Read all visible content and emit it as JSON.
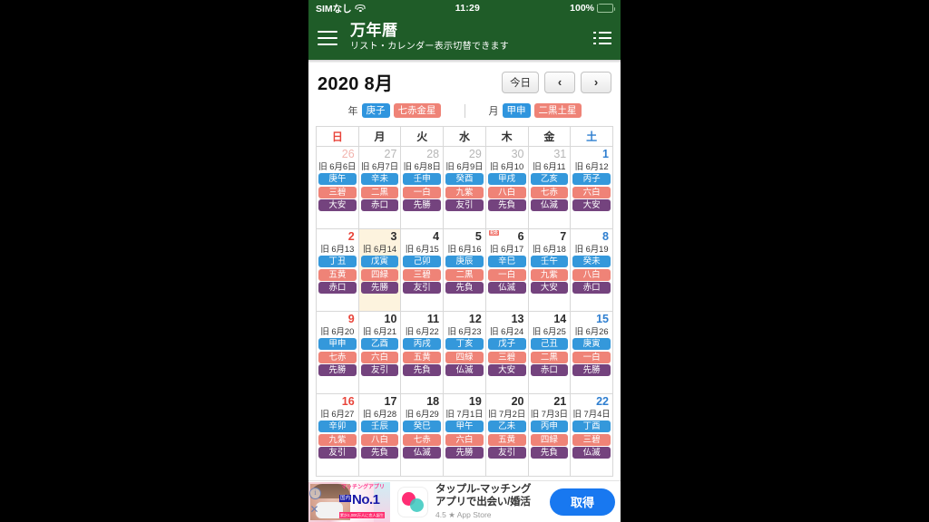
{
  "status_bar": {
    "carrier": "SIMなし",
    "time": "11:29",
    "battery": "100%",
    "wifi_icon": "wifi-icon",
    "battery_icon": "battery-charging-icon"
  },
  "app_bar": {
    "menu_icon": "hamburger-menu-icon",
    "title": "万年暦",
    "subtitle": "リスト・カレンダー表示切替できます",
    "list_icon": "list-view-icon"
  },
  "month_header": {
    "title": "2020 8月",
    "today_button": "今日",
    "prev_button": "‹",
    "next_button": "›"
  },
  "eto_row": {
    "year_label": "年",
    "year_kanshi": "庚子",
    "year_kyusei": "七赤金星",
    "month_label": "月",
    "month_kanshi": "甲申",
    "month_kyusei": "二黒土星"
  },
  "calendar": {
    "weekdays": [
      "日",
      "月",
      "火",
      "水",
      "木",
      "金",
      "土"
    ],
    "weeks": [
      [
        {
          "day": "26",
          "kyureki": "旧 6月6日",
          "kanshi": "庚午",
          "kyusei": "三碧",
          "rokuyo": "大安",
          "outside": true,
          "today": false,
          "holiday": false
        },
        {
          "day": "27",
          "kyureki": "旧 6月7日",
          "kanshi": "辛未",
          "kyusei": "二黒",
          "rokuyo": "赤口",
          "outside": true,
          "today": false,
          "holiday": false
        },
        {
          "day": "28",
          "kyureki": "旧 6月8日",
          "kanshi": "壬申",
          "kyusei": "一白",
          "rokuyo": "先勝",
          "outside": true,
          "today": false,
          "holiday": false
        },
        {
          "day": "29",
          "kyureki": "旧 6月9日",
          "kanshi": "癸酉",
          "kyusei": "九紫",
          "rokuyo": "友引",
          "outside": true,
          "today": false,
          "holiday": false
        },
        {
          "day": "30",
          "kyureki": "旧 6月10",
          "kanshi": "甲戌",
          "kyusei": "八白",
          "rokuyo": "先負",
          "outside": true,
          "today": false,
          "holiday": false
        },
        {
          "day": "31",
          "kyureki": "旧 6月11",
          "kanshi": "乙亥",
          "kyusei": "七赤",
          "rokuyo": "仏滅",
          "outside": true,
          "today": false,
          "holiday": false
        },
        {
          "day": "1",
          "kyureki": "旧 6月12",
          "kanshi": "丙子",
          "kyusei": "六白",
          "rokuyo": "大安",
          "outside": false,
          "today": false,
          "holiday": false
        }
      ],
      [
        {
          "day": "2",
          "kyureki": "旧 6月13",
          "kanshi": "丁丑",
          "kyusei": "五黄",
          "rokuyo": "赤口",
          "outside": false,
          "today": false,
          "holiday": false
        },
        {
          "day": "3",
          "kyureki": "旧 6月14",
          "kanshi": "戊寅",
          "kyusei": "四緑",
          "rokuyo": "先勝",
          "outside": false,
          "today": true,
          "holiday": false
        },
        {
          "day": "4",
          "kyureki": "旧 6月15",
          "kanshi": "己卯",
          "kyusei": "三碧",
          "rokuyo": "友引",
          "outside": false,
          "today": false,
          "holiday": false
        },
        {
          "day": "5",
          "kyureki": "旧 6月16",
          "kanshi": "庚辰",
          "kyusei": "二黒",
          "rokuyo": "先負",
          "outside": false,
          "today": false,
          "holiday": false
        },
        {
          "day": "6",
          "kyureki": "旧 6月17",
          "kanshi": "辛巳",
          "kyusei": "一白",
          "rokuyo": "仏滅",
          "outside": false,
          "today": false,
          "holiday": true,
          "holiday_label": "記念"
        },
        {
          "day": "7",
          "kyureki": "旧 6月18",
          "kanshi": "壬午",
          "kyusei": "九紫",
          "rokuyo": "大安",
          "outside": false,
          "today": false,
          "holiday": false
        },
        {
          "day": "8",
          "kyureki": "旧 6月19",
          "kanshi": "癸未",
          "kyusei": "八白",
          "rokuyo": "赤口",
          "outside": false,
          "today": false,
          "holiday": false
        }
      ],
      [
        {
          "day": "9",
          "kyureki": "旧 6月20",
          "kanshi": "甲申",
          "kyusei": "七赤",
          "rokuyo": "先勝",
          "outside": false,
          "today": false,
          "holiday": false
        },
        {
          "day": "10",
          "kyureki": "旧 6月21",
          "kanshi": "乙酉",
          "kyusei": "六白",
          "rokuyo": "友引",
          "outside": false,
          "today": false,
          "holiday": false
        },
        {
          "day": "11",
          "kyureki": "旧 6月22",
          "kanshi": "丙戌",
          "kyusei": "五黄",
          "rokuyo": "先負",
          "outside": false,
          "today": false,
          "holiday": false
        },
        {
          "day": "12",
          "kyureki": "旧 6月23",
          "kanshi": "丁亥",
          "kyusei": "四緑",
          "rokuyo": "仏滅",
          "outside": false,
          "today": false,
          "holiday": false
        },
        {
          "day": "13",
          "kyureki": "旧 6月24",
          "kanshi": "戊子",
          "kyusei": "三碧",
          "rokuyo": "大安",
          "outside": false,
          "today": false,
          "holiday": false
        },
        {
          "day": "14",
          "kyureki": "旧 6月25",
          "kanshi": "己丑",
          "kyusei": "二黒",
          "rokuyo": "赤口",
          "outside": false,
          "today": false,
          "holiday": false
        },
        {
          "day": "15",
          "kyureki": "旧 6月26",
          "kanshi": "庚寅",
          "kyusei": "一白",
          "rokuyo": "先勝",
          "outside": false,
          "today": false,
          "holiday": false
        }
      ],
      [
        {
          "day": "16",
          "kyureki": "旧 6月27",
          "kanshi": "辛卯",
          "kyusei": "九紫",
          "rokuyo": "友引",
          "outside": false,
          "today": false,
          "holiday": false
        },
        {
          "day": "17",
          "kyureki": "旧 6月28",
          "kanshi": "壬辰",
          "kyusei": "八白",
          "rokuyo": "先負",
          "outside": false,
          "today": false,
          "holiday": false
        },
        {
          "day": "18",
          "kyureki": "旧 6月29",
          "kanshi": "癸巳",
          "kyusei": "七赤",
          "rokuyo": "仏滅",
          "outside": false,
          "today": false,
          "holiday": false
        },
        {
          "day": "19",
          "kyureki": "旧 7月1日",
          "kanshi": "甲午",
          "kyusei": "六白",
          "rokuyo": "先勝",
          "outside": false,
          "today": false,
          "holiday": false
        },
        {
          "day": "20",
          "kyureki": "旧 7月2日",
          "kanshi": "乙未",
          "kyusei": "五黄",
          "rokuyo": "友引",
          "outside": false,
          "today": false,
          "holiday": false
        },
        {
          "day": "21",
          "kyureki": "旧 7月3日",
          "kanshi": "丙申",
          "kyusei": "四緑",
          "rokuyo": "先負",
          "outside": false,
          "today": false,
          "holiday": false
        },
        {
          "day": "22",
          "kyureki": "旧 7月4日",
          "kanshi": "丁酉",
          "kyusei": "三碧",
          "rokuyo": "仏滅",
          "outside": false,
          "today": false,
          "holiday": false
        }
      ]
    ]
  },
  "ad": {
    "thumb_headline": "マッチングアプリ",
    "thumb_kokunai": "国内",
    "thumb_no1": "No.1",
    "thumb_footer": "累計1,000万人に恋人誕生",
    "title_line1": "タップル-マッチング",
    "title_line2": "アプリで出会い/婚活",
    "rating": "4.5",
    "store": "App Store",
    "cta": "取得",
    "info_icon": "info-icon",
    "close_icon": "close-icon",
    "app_icon": "tapple-app-icon"
  },
  "colors": {
    "brand_green": "#1f5c28",
    "chip_blue": "#3498db",
    "chip_red": "#ef8377",
    "chip_purple": "#74437e",
    "sunday_red": "#e8443a",
    "saturday_blue": "#2f7fd0",
    "today_bg": "#fdf3de",
    "cta_blue": "#1878f0"
  }
}
